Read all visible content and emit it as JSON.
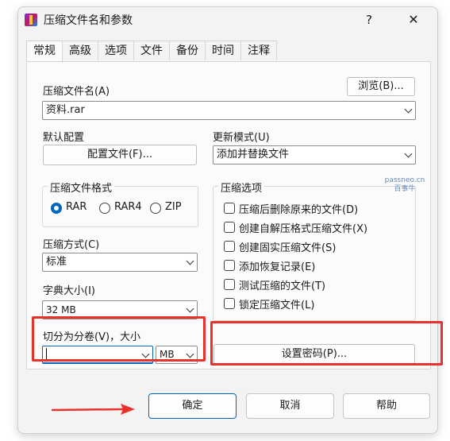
{
  "window": {
    "title": "压缩文件名和参数",
    "help_glyph": "?",
    "close_glyph": "✕"
  },
  "tabs": [
    {
      "label": "常规",
      "active": true
    },
    {
      "label": "高级"
    },
    {
      "label": "选项"
    },
    {
      "label": "文件"
    },
    {
      "label": "备份"
    },
    {
      "label": "时间"
    },
    {
      "label": "注释"
    }
  ],
  "general": {
    "archive_name_label": "压缩文件名(A)",
    "browse_button": "浏览(B)...",
    "archive_name_value": "资料.rar",
    "default_profile_label": "默认配置",
    "profiles_button": "配置文件(F)...",
    "update_mode_label": "更新模式(U)",
    "update_mode_value": "添加并替换文件",
    "format_group_label": "压缩文件格式",
    "formats": [
      {
        "label": "RAR",
        "selected": true
      },
      {
        "label": "RAR4",
        "selected": false
      },
      {
        "label": "ZIP",
        "selected": false
      }
    ],
    "method_label": "压缩方式(C)",
    "method_value": "标准",
    "dict_label": "字典大小(I)",
    "dict_value": "32 MB",
    "split_label": "切分为分卷(V)，大小",
    "split_value": "",
    "split_unit": "MB",
    "options_group_label": "压缩选项",
    "options": [
      {
        "label": "压缩后删除原来的文件(D)",
        "checked": false
      },
      {
        "label": "创建自解压格式压缩文件(X)",
        "checked": false
      },
      {
        "label": "创建固实压缩文件(S)",
        "checked": false
      },
      {
        "label": "添加恢复记录(E)",
        "checked": false
      },
      {
        "label": "测试压缩的文件(T)",
        "checked": false
      },
      {
        "label": "锁定压缩文件(L)",
        "checked": false
      }
    ],
    "set_password_button": "设置密码(P)..."
  },
  "watermark": {
    "line1": "passneo.cn",
    "line2": "百事牛"
  },
  "buttons": {
    "ok": "确定",
    "cancel": "取消",
    "help": "帮助"
  },
  "colors": {
    "annotation_red": "#e8322b",
    "accent_blue": "#0067c0"
  }
}
